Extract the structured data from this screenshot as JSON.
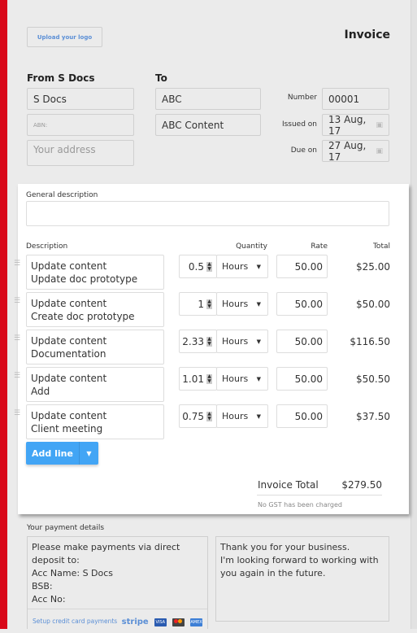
{
  "header": {
    "upload_logo": "Upload your logo",
    "title": "Invoice"
  },
  "from": {
    "label": "From S Docs",
    "name": "S Docs",
    "abn_placeholder": "ABN:",
    "address_placeholder": "Your address"
  },
  "to": {
    "label": "To",
    "name": "ABC",
    "company": "ABC Content"
  },
  "meta": {
    "number_label": "Number",
    "number": "00001",
    "issued_label": "Issued on",
    "issued": "13 Aug, 17",
    "due_label": "Due on",
    "due": "27 Aug, 17"
  },
  "general_description": {
    "label": "General description",
    "value": ""
  },
  "columns": {
    "description": "Description",
    "quantity": "Quantity",
    "rate": "Rate",
    "total": "Total"
  },
  "lines": [
    {
      "line1": "Update content",
      "line2": "Update doc prototype",
      "qty": "0.5",
      "unit": "Hours",
      "rate": "50.00",
      "total": "$25.00"
    },
    {
      "line1": "Update content",
      "line2": "Create doc prototype",
      "qty": "1",
      "unit": "Hours",
      "rate": "50.00",
      "total": "$50.00"
    },
    {
      "line1": "Update content",
      "line2": "Documentation",
      "qty": "2.33",
      "unit": "Hours",
      "rate": "50.00",
      "total": "$116.50"
    },
    {
      "line1": "Update content",
      "line2": "Add",
      "qty": "1.01",
      "unit": "Hours",
      "rate": "50.00",
      "total": "$50.50"
    },
    {
      "line1": "Update content",
      "line2": "Client meeting",
      "qty": "0.75",
      "unit": "Hours",
      "rate": "50.00",
      "total": "$37.50"
    }
  ],
  "add_line": "Add line",
  "summary": {
    "total_label": "Invoice Total",
    "total": "$279.50",
    "gst_note": "No GST has been charged"
  },
  "payment": {
    "label": "Your payment details",
    "lines": [
      "Please make payments via direct",
      "deposit to:",
      "Acc Name: S Docs",
      "BSB:",
      "Acc No:"
    ],
    "setup_link": "Setup credit card payments",
    "stripe": "stripe",
    "visa": "VISA",
    "amex": "AMEX"
  },
  "notes": {
    "lines": [
      "Thank you for your business.",
      "I'm looking forward to working with",
      "you again in the future."
    ]
  },
  "colors": {
    "accent_red": "#d9091a",
    "button_blue": "#42a5f5",
    "link_blue": "#5b8fd6"
  }
}
